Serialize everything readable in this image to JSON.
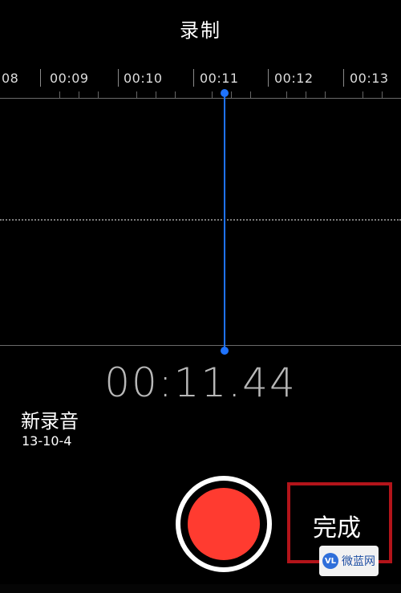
{
  "header": {
    "title": "录制"
  },
  "timeline": {
    "labels": [
      "08",
      "00:09",
      "00:10",
      "00:11",
      "00:12",
      "00:13"
    ]
  },
  "timer": {
    "value": "00:11.44"
  },
  "recording": {
    "name": "新录音",
    "date": "13-10-4"
  },
  "controls": {
    "done_label": "完成"
  },
  "watermark": {
    "text": "微蓝网"
  }
}
